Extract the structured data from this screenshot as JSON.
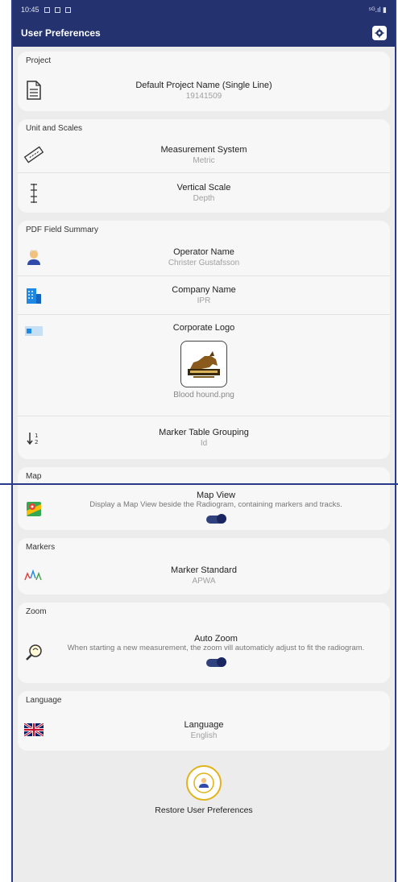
{
  "status": {
    "time": "10:45",
    "right": "⁵ᴳ.ıl ▮"
  },
  "header": {
    "title": "User Preferences"
  },
  "project": {
    "section_label": "Project",
    "default_name_label": "Default Project Name (Single Line)",
    "default_name_value": "19141509"
  },
  "units": {
    "section_label": "Unit and Scales",
    "measurement_label": "Measurement System",
    "measurement_value": "Metric",
    "vertical_label": "Vertical Scale",
    "vertical_value": "Depth"
  },
  "pdf": {
    "section_label": "PDF Field Summary",
    "operator_label": "Operator Name",
    "operator_value": "Christer Gustafsson",
    "company_label": "Company Name",
    "company_value": "IPR",
    "logo_label": "Corporate Logo",
    "logo_file": "Blood hound.png",
    "marker_grouping_label": "Marker Table Grouping",
    "marker_grouping_value": "Id"
  },
  "map": {
    "section_label": "Map",
    "label": "Map View",
    "description": "Display a Map View beside the Radiogram, containing markers and tracks.",
    "enabled": true
  },
  "markers": {
    "section_label": "Markers",
    "label": "Marker Standard",
    "value": "APWA"
  },
  "zoom": {
    "section_label": "Zoom",
    "label": "Auto Zoom",
    "description": "When starting a new measurement, the zoom vill automaticly adjust to fit the radiogram.",
    "enabled": true
  },
  "language": {
    "section_label": "Language",
    "label": "Language",
    "value": "English"
  },
  "restore": {
    "label": "Restore User Preferences"
  },
  "colors": {
    "header_bg": "#24336f",
    "accent": "#31417d",
    "restore_ring": "#e2b21a"
  }
}
